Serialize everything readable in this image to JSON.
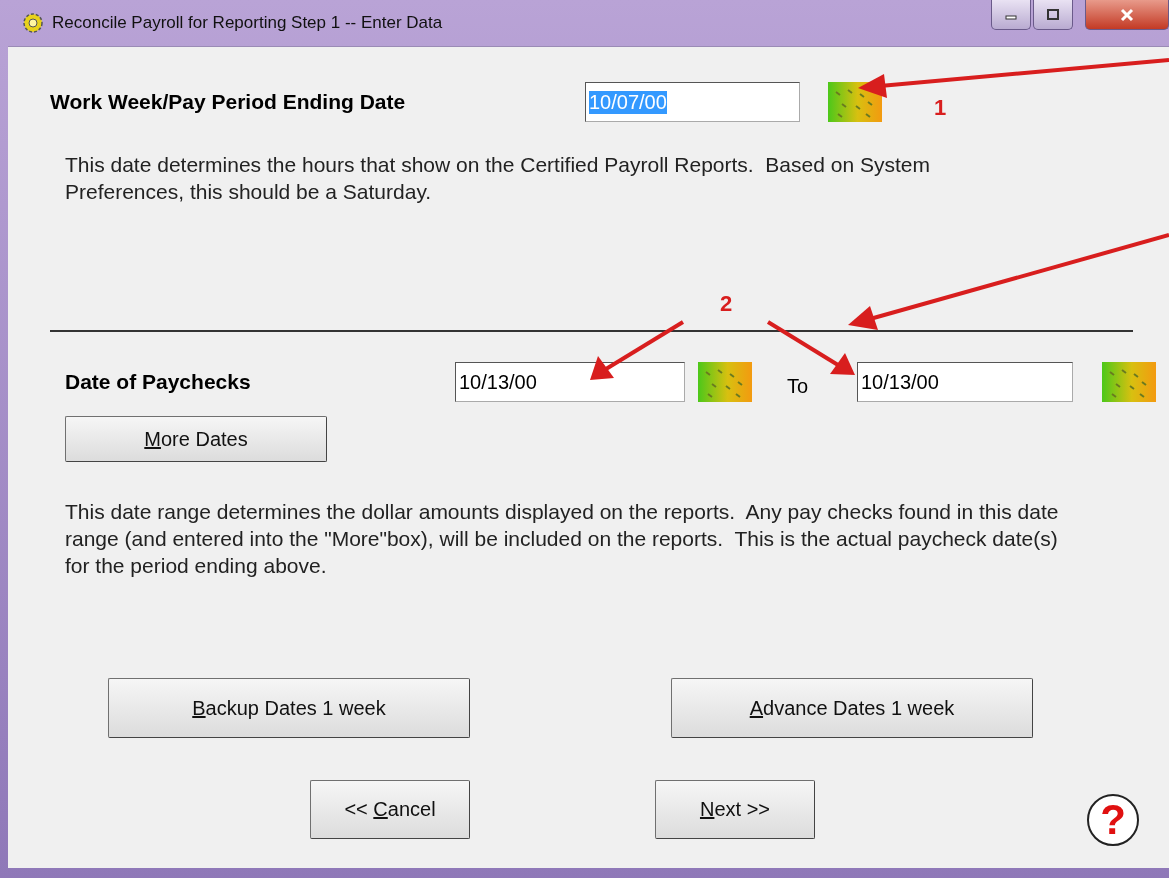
{
  "window": {
    "title": "Reconcile Payroll for Reporting Step 1 -- Enter Data",
    "controls": [
      {
        "kind": "minimize"
      },
      {
        "kind": "maximize"
      },
      {
        "kind": "close"
      }
    ]
  },
  "period": {
    "label": "Work Week/Pay Period Ending Date",
    "value": "10/07/00",
    "text_selected": true,
    "note": "This date determines the hours that show on the Certified Payroll Reports.  Based on System Preferences, this should be a Saturday."
  },
  "paychecks": {
    "label": "Date of Paychecks",
    "from": {
      "value": "10/13/00",
      "text_selected": false
    },
    "to_label": "To",
    "to": {
      "value": "10/13/00",
      "text_selected": false
    },
    "more_button": {
      "key": "M",
      "after": "ore Dates"
    },
    "note": "This date range determines the dollar amounts displayed on the reports.  Any pay checks found in this date range (and entered into the \"More\"box), will be included on the reports.  This is the actual paycheck date(s) for the period ending above."
  },
  "shift_buttons": [
    {
      "key": "B",
      "after": "ackup Dates 1 week"
    },
    {
      "key": "A",
      "after": "dvance Dates 1 week"
    }
  ],
  "nav_buttons": [
    {
      "before": "<< ",
      "key": "C",
      "after": "ancel"
    },
    {
      "key": "N",
      "after": "ext >>"
    }
  ],
  "help": {
    "glyph": "?"
  },
  "annotations": [
    {
      "label": "1"
    },
    {
      "label": "2"
    }
  ]
}
